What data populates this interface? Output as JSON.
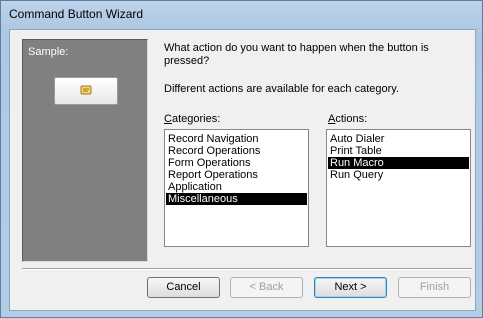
{
  "window": {
    "title": "Command Button Wizard"
  },
  "sample": {
    "label": "Sample:",
    "icon": "macro-scroll-icon"
  },
  "prompt": {
    "question": "What action do you want to happen when the button is pressed?",
    "hint": "Different actions are available for each category."
  },
  "categories": {
    "label": "Categories:",
    "items": [
      "Record Navigation",
      "Record Operations",
      "Form Operations",
      "Report Operations",
      "Application",
      "Miscellaneous"
    ],
    "selected": "Miscellaneous"
  },
  "actions": {
    "label": "Actions:",
    "items": [
      "Auto Dialer",
      "Print Table",
      "Run Macro",
      "Run Query"
    ],
    "selected": "Run Macro"
  },
  "buttons": {
    "cancel": "Cancel",
    "back": "< Back",
    "next": "Next >",
    "finish": "Finish"
  }
}
